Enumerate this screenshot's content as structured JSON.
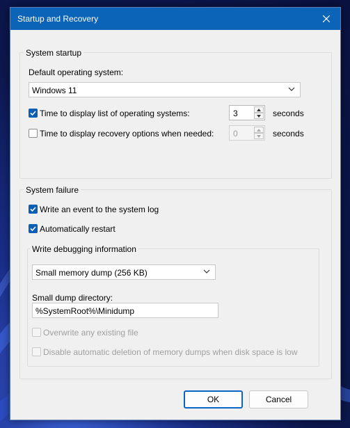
{
  "dialog": {
    "title": "Startup and Recovery"
  },
  "system_startup": {
    "legend": "System startup",
    "default_os_label": "Default operating system:",
    "default_os_value": "Windows 11",
    "display_list": {
      "checked": true,
      "label": "Time to display list of operating systems:",
      "value": "3",
      "unit": "seconds"
    },
    "display_recovery": {
      "checked": false,
      "label": "Time to display recovery options when needed:",
      "value": "0",
      "unit": "seconds"
    }
  },
  "system_failure": {
    "legend": "System failure",
    "write_event": {
      "checked": true,
      "label": "Write an event to the system log"
    },
    "auto_restart": {
      "checked": true,
      "label": "Automatically restart"
    },
    "debugging": {
      "legend": "Write debugging information",
      "dump_type": "Small memory dump (256 KB)",
      "dump_dir_label": "Small dump directory:",
      "dump_dir_value": "%SystemRoot%\\Minidump",
      "overwrite": {
        "checked": false,
        "label": "Overwrite any existing file"
      },
      "disable_auto_delete": {
        "checked": false,
        "label": "Disable automatic deletion of memory dumps when disk space is low"
      }
    }
  },
  "buttons": {
    "ok": "OK",
    "cancel": "Cancel"
  },
  "colors": {
    "accent": "#0a5fb4",
    "titlebar": "#0b64b8"
  }
}
